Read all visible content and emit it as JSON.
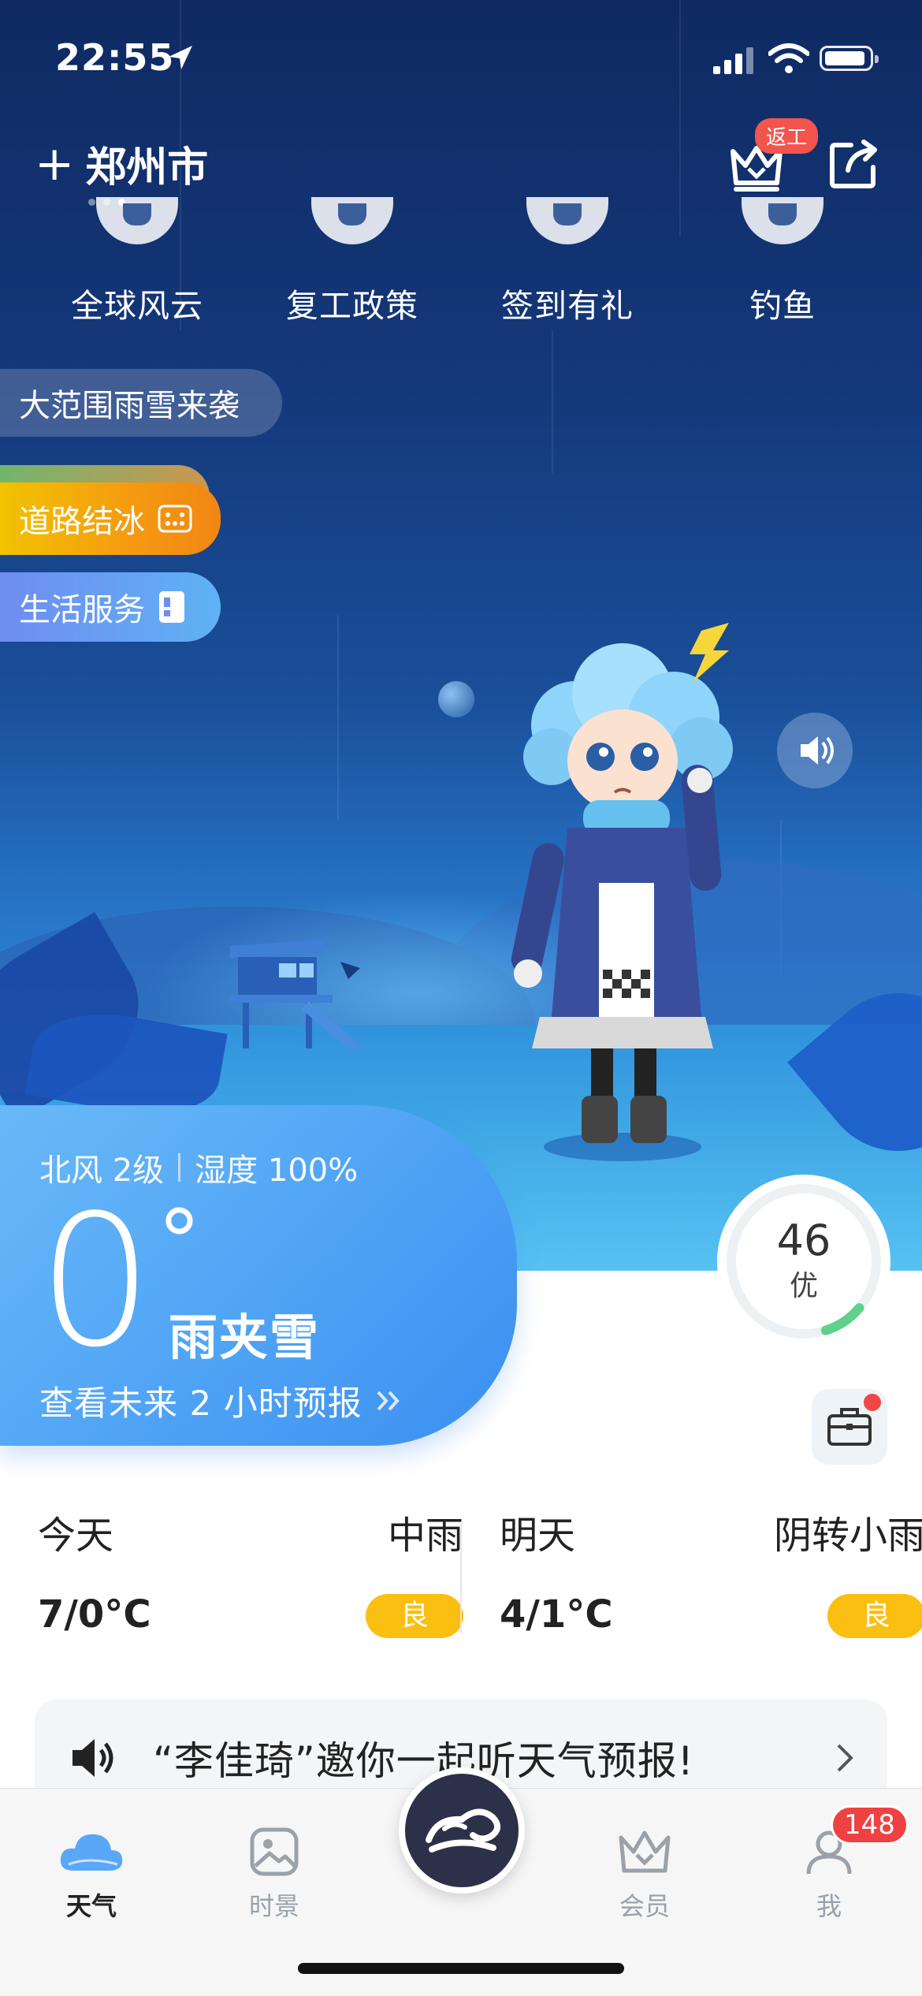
{
  "status_bar": {
    "time": "22:55"
  },
  "header": {
    "city": "郑州市",
    "add_symbol": "+",
    "vip_badge": "返工"
  },
  "quick_entries": [
    {
      "label": "全球风云",
      "icon": "globe-icon"
    },
    {
      "label": "复工政策",
      "icon": "policy-icon"
    },
    {
      "label": "签到有礼",
      "icon": "checkin-icon"
    },
    {
      "label": "钓鱼",
      "icon": "fishing-icon"
    }
  ],
  "tags": {
    "alert": "大范围雨雪来袭",
    "road": "道路结冰",
    "life": "生活服务"
  },
  "current": {
    "wind": "北风 2级",
    "humidity": "湿度 100%",
    "temperature": "0",
    "degree": "°",
    "condition": "雨夹雪",
    "forecast_link": "查看未来 2 小时预报"
  },
  "aqi": {
    "value": "46",
    "level": "优",
    "fraction": 0.09,
    "color": "#5fd18a"
  },
  "days": [
    {
      "name": "今天",
      "desc": "中雨",
      "range": "7/0°C",
      "aq": "良"
    },
    {
      "name": "明天",
      "desc": "阴转小雨",
      "range": "4/1°C",
      "aq": "良"
    }
  ],
  "invite": {
    "text": "“李佳琦”邀你一起听天气预报!"
  },
  "tabs": [
    {
      "label": "天气",
      "icon": "cloud-icon"
    },
    {
      "label": "时景",
      "icon": "photo-icon"
    },
    {
      "label": "会员",
      "icon": "crown-icon"
    },
    {
      "label": "我",
      "icon": "person-icon"
    }
  ],
  "profile_badge": "148",
  "colors": {
    "accent": "#4fa3f5",
    "badge": "#ef4141",
    "aq_good": "#fbbf12"
  }
}
